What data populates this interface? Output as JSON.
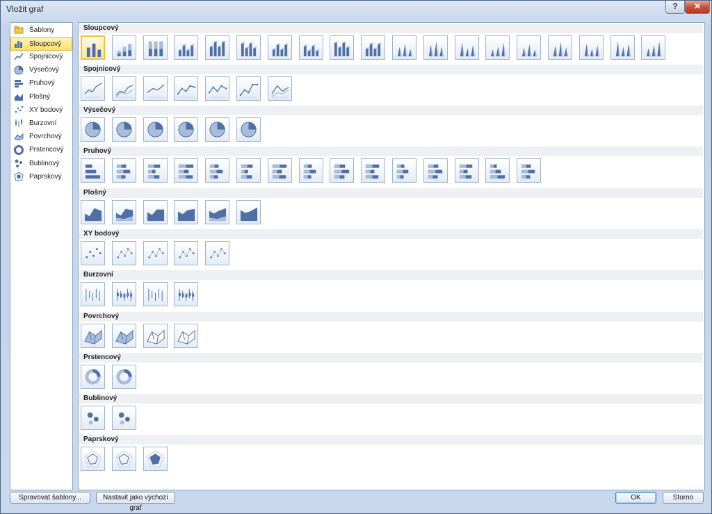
{
  "window": {
    "title": "Vložit graf"
  },
  "titlebar": {
    "help_label": "?",
    "close_label": "✕"
  },
  "nav": [
    {
      "label": "Šablony",
      "icon": "folder-icon",
      "selected": false
    },
    {
      "label": "Sloupcový",
      "icon": "column-chart-icon",
      "selected": true
    },
    {
      "label": "Spojnicový",
      "icon": "line-chart-icon",
      "selected": false
    },
    {
      "label": "Výsečový",
      "icon": "pie-chart-icon",
      "selected": false
    },
    {
      "label": "Pruhový",
      "icon": "bar-chart-icon",
      "selected": false
    },
    {
      "label": "Plošný",
      "icon": "area-chart-icon",
      "selected": false
    },
    {
      "label": "XY bodový",
      "icon": "scatter-chart-icon",
      "selected": false
    },
    {
      "label": "Burzovní",
      "icon": "stock-chart-icon",
      "selected": false
    },
    {
      "label": "Povrchový",
      "icon": "surface-chart-icon",
      "selected": false
    },
    {
      "label": "Prstencový",
      "icon": "doughnut-chart-icon",
      "selected": false
    },
    {
      "label": "Bublinový",
      "icon": "bubble-chart-icon",
      "selected": false
    },
    {
      "label": "Paprskový",
      "icon": "radar-chart-icon",
      "selected": false
    }
  ],
  "sections": [
    {
      "title": "Sloupcový",
      "kind": "column",
      "count": 19
    },
    {
      "title": "Spojnicový",
      "kind": "line",
      "count": 7
    },
    {
      "title": "Výsečový",
      "kind": "pie",
      "count": 6
    },
    {
      "title": "Pruhový",
      "kind": "bar",
      "count": 15
    },
    {
      "title": "Plošný",
      "kind": "area",
      "count": 6
    },
    {
      "title": "XY bodový",
      "kind": "scatter",
      "count": 5
    },
    {
      "title": "Burzovní",
      "kind": "stock",
      "count": 4
    },
    {
      "title": "Povrchový",
      "kind": "surface",
      "count": 4
    },
    {
      "title": "Prstencový",
      "kind": "doughnut",
      "count": 2
    },
    {
      "title": "Bublinový",
      "kind": "bubble",
      "count": 2
    },
    {
      "title": "Paprskový",
      "kind": "radar",
      "count": 3
    }
  ],
  "footer": {
    "manage_label": "Spravovat šablony...",
    "default_label": "Nastavit jako výchozí graf",
    "ok_label": "OK",
    "cancel_label": "Storno"
  },
  "colors": {
    "accent": "#f3c13a",
    "chart_fill": "#4f6fa6",
    "chart_light": "#a9bcd9"
  }
}
